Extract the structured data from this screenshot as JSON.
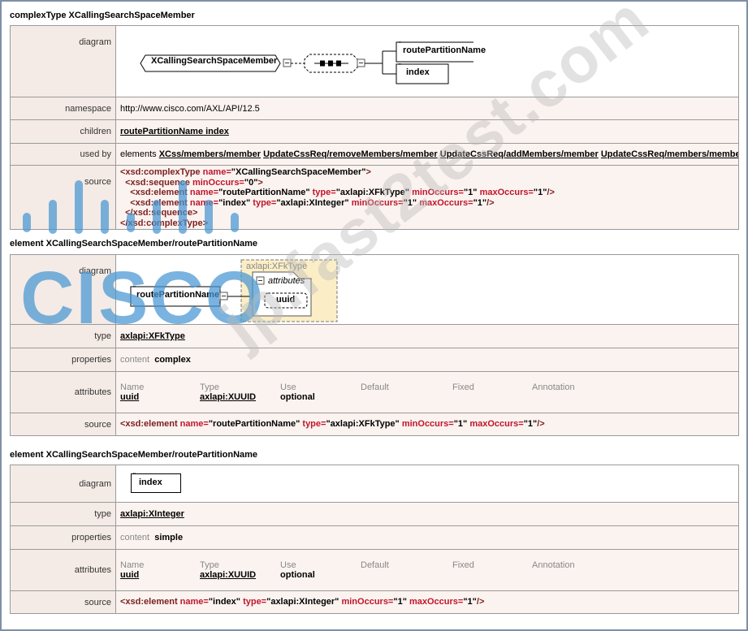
{
  "section1": {
    "heading": "complexType XCallingSearchSpaceMember",
    "diagram_label": "diagram",
    "diagram": {
      "root": "XCallingSearchSpaceMember",
      "child1": "routePartitionName",
      "child2": "index"
    },
    "namespace_label": "namespace",
    "namespace": "http://www.cisco.com/AXL/API/12.5",
    "children_label": "children",
    "children": "routePartitionName index",
    "usedby_label": "used by",
    "usedby_prefix": "elements",
    "usedby_links": [
      "XCss/members/member",
      "UpdateCssReq/removeMembers/member",
      "UpdateCssReq/addMembers/member",
      "UpdateCssReq/members/member"
    ],
    "source_label": "source",
    "source_lines": [
      [
        "<xsd:complexType ",
        "name=",
        "\"XCallingSearchSpaceMember\"",
        ">"
      ],
      [
        "  <xsd:sequence ",
        "minOccurs=",
        "\"0\"",
        ">"
      ],
      [
        "    <xsd:element ",
        "name=",
        "\"routePartitionName\" ",
        "type=",
        "\"axlapi:XFkType\" ",
        "minOccurs=",
        "\"1\" ",
        "maxOccurs=",
        "\"1\"",
        "/>"
      ],
      [
        "    <xsd:element ",
        "name=",
        "\"index\" ",
        "type=",
        "\"axlapi:XInteger\" ",
        "minOccurs=",
        "\"1\" ",
        "maxOccurs=",
        "\"1\"",
        "/>"
      ],
      [
        "  </xsd:sequence>"
      ],
      [
        "</xsd:complexType>"
      ]
    ]
  },
  "section2": {
    "heading": "element XCallingSearchSpaceMember/routePartitionName",
    "diagram_label": "diagram",
    "diagram": {
      "element": "routePartitionName",
      "type_box": "axlapi:XFkType",
      "attributes": "attributes",
      "attr": "uuid"
    },
    "type_label": "type",
    "type_value": "axlapi:XFkType",
    "properties_label": "properties",
    "properties_key": "content",
    "properties_value": "complex",
    "attributes_label": "attributes",
    "attr_headers": [
      "Name",
      "Type",
      "Use",
      "Default",
      "Fixed",
      "Annotation"
    ],
    "attr_row": [
      "uuid",
      "axlapi:XUUID",
      "optional",
      "",
      "",
      ""
    ],
    "source_label": "source",
    "source": [
      "<xsd:element ",
      "name=",
      "\"routePartitionName\" ",
      "type=",
      "\"axlapi:XFkType\" ",
      "minOccurs=",
      "\"1\" ",
      "maxOccurs=",
      "\"1\"",
      "/>"
    ]
  },
  "section3": {
    "heading": "element XCallingSearchSpaceMember/routePartitionName",
    "diagram_label": "diagram",
    "diagram": {
      "element": "index"
    },
    "type_label": "type",
    "type_value": "axlapi:XInteger",
    "properties_label": "properties",
    "properties_key": "content",
    "properties_value": "simple",
    "attributes_label": "attributes",
    "attr_headers": [
      "Name",
      "Type",
      "Use",
      "Default",
      "Fixed",
      "Annotation"
    ],
    "attr_row": [
      "uuid",
      "axlapi:XUUID",
      "optional",
      "",
      "",
      ""
    ],
    "source_label": "source",
    "source": [
      "<xsd:element ",
      "name=",
      "\"index\" ",
      "type=",
      "\"axlapi:XInteger\" ",
      "minOccurs=",
      "\"1\" ",
      "maxOccurs=",
      "\"1\"",
      "/>"
    ]
  },
  "watermark": {
    "brand": "CISCO",
    "site": "jp.fast2test.com"
  },
  "colors": {
    "key_cell_bg": "#f4ebe6",
    "value_cell_bg": "#fbf3ef",
    "tag": "#7a1f1f",
    "attr_name": "#c0152d",
    "type_box_bg": "#fbeec7",
    "watermark_blue": "#4696d2"
  }
}
